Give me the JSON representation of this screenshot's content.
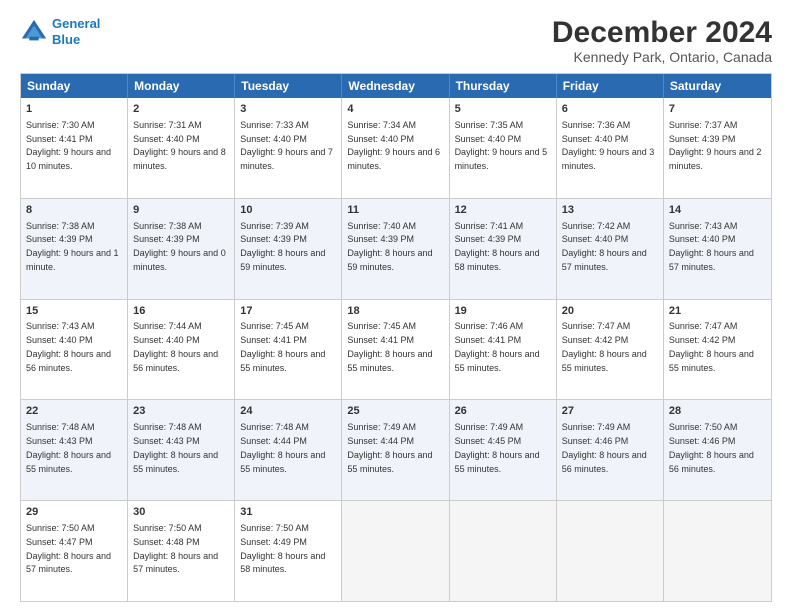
{
  "header": {
    "logo_line1": "General",
    "logo_line2": "Blue",
    "title": "December 2024",
    "subtitle": "Kennedy Park, Ontario, Canada"
  },
  "days": [
    "Sunday",
    "Monday",
    "Tuesday",
    "Wednesday",
    "Thursday",
    "Friday",
    "Saturday"
  ],
  "weeks": [
    [
      {
        "day": "1",
        "info": "Sunrise: 7:30 AM\nSunset: 4:41 PM\nDaylight: 9 hours and 10 minutes."
      },
      {
        "day": "2",
        "info": "Sunrise: 7:31 AM\nSunset: 4:40 PM\nDaylight: 9 hours and 8 minutes."
      },
      {
        "day": "3",
        "info": "Sunrise: 7:33 AM\nSunset: 4:40 PM\nDaylight: 9 hours and 7 minutes."
      },
      {
        "day": "4",
        "info": "Sunrise: 7:34 AM\nSunset: 4:40 PM\nDaylight: 9 hours and 6 minutes."
      },
      {
        "day": "5",
        "info": "Sunrise: 7:35 AM\nSunset: 4:40 PM\nDaylight: 9 hours and 5 minutes."
      },
      {
        "day": "6",
        "info": "Sunrise: 7:36 AM\nSunset: 4:40 PM\nDaylight: 9 hours and 3 minutes."
      },
      {
        "day": "7",
        "info": "Sunrise: 7:37 AM\nSunset: 4:39 PM\nDaylight: 9 hours and 2 minutes."
      }
    ],
    [
      {
        "day": "8",
        "info": "Sunrise: 7:38 AM\nSunset: 4:39 PM\nDaylight: 9 hours and 1 minute."
      },
      {
        "day": "9",
        "info": "Sunrise: 7:38 AM\nSunset: 4:39 PM\nDaylight: 9 hours and 0 minutes."
      },
      {
        "day": "10",
        "info": "Sunrise: 7:39 AM\nSunset: 4:39 PM\nDaylight: 8 hours and 59 minutes."
      },
      {
        "day": "11",
        "info": "Sunrise: 7:40 AM\nSunset: 4:39 PM\nDaylight: 8 hours and 59 minutes."
      },
      {
        "day": "12",
        "info": "Sunrise: 7:41 AM\nSunset: 4:39 PM\nDaylight: 8 hours and 58 minutes."
      },
      {
        "day": "13",
        "info": "Sunrise: 7:42 AM\nSunset: 4:40 PM\nDaylight: 8 hours and 57 minutes."
      },
      {
        "day": "14",
        "info": "Sunrise: 7:43 AM\nSunset: 4:40 PM\nDaylight: 8 hours and 57 minutes."
      }
    ],
    [
      {
        "day": "15",
        "info": "Sunrise: 7:43 AM\nSunset: 4:40 PM\nDaylight: 8 hours and 56 minutes."
      },
      {
        "day": "16",
        "info": "Sunrise: 7:44 AM\nSunset: 4:40 PM\nDaylight: 8 hours and 56 minutes."
      },
      {
        "day": "17",
        "info": "Sunrise: 7:45 AM\nSunset: 4:41 PM\nDaylight: 8 hours and 55 minutes."
      },
      {
        "day": "18",
        "info": "Sunrise: 7:45 AM\nSunset: 4:41 PM\nDaylight: 8 hours and 55 minutes."
      },
      {
        "day": "19",
        "info": "Sunrise: 7:46 AM\nSunset: 4:41 PM\nDaylight: 8 hours and 55 minutes."
      },
      {
        "day": "20",
        "info": "Sunrise: 7:47 AM\nSunset: 4:42 PM\nDaylight: 8 hours and 55 minutes."
      },
      {
        "day": "21",
        "info": "Sunrise: 7:47 AM\nSunset: 4:42 PM\nDaylight: 8 hours and 55 minutes."
      }
    ],
    [
      {
        "day": "22",
        "info": "Sunrise: 7:48 AM\nSunset: 4:43 PM\nDaylight: 8 hours and 55 minutes."
      },
      {
        "day": "23",
        "info": "Sunrise: 7:48 AM\nSunset: 4:43 PM\nDaylight: 8 hours and 55 minutes."
      },
      {
        "day": "24",
        "info": "Sunrise: 7:48 AM\nSunset: 4:44 PM\nDaylight: 8 hours and 55 minutes."
      },
      {
        "day": "25",
        "info": "Sunrise: 7:49 AM\nSunset: 4:44 PM\nDaylight: 8 hours and 55 minutes."
      },
      {
        "day": "26",
        "info": "Sunrise: 7:49 AM\nSunset: 4:45 PM\nDaylight: 8 hours and 55 minutes."
      },
      {
        "day": "27",
        "info": "Sunrise: 7:49 AM\nSunset: 4:46 PM\nDaylight: 8 hours and 56 minutes."
      },
      {
        "day": "28",
        "info": "Sunrise: 7:50 AM\nSunset: 4:46 PM\nDaylight: 8 hours and 56 minutes."
      }
    ],
    [
      {
        "day": "29",
        "info": "Sunrise: 7:50 AM\nSunset: 4:47 PM\nDaylight: 8 hours and 57 minutes."
      },
      {
        "day": "30",
        "info": "Sunrise: 7:50 AM\nSunset: 4:48 PM\nDaylight: 8 hours and 57 minutes."
      },
      {
        "day": "31",
        "info": "Sunrise: 7:50 AM\nSunset: 4:49 PM\nDaylight: 8 hours and 58 minutes."
      },
      {
        "day": "",
        "info": ""
      },
      {
        "day": "",
        "info": ""
      },
      {
        "day": "",
        "info": ""
      },
      {
        "day": "",
        "info": ""
      }
    ]
  ]
}
